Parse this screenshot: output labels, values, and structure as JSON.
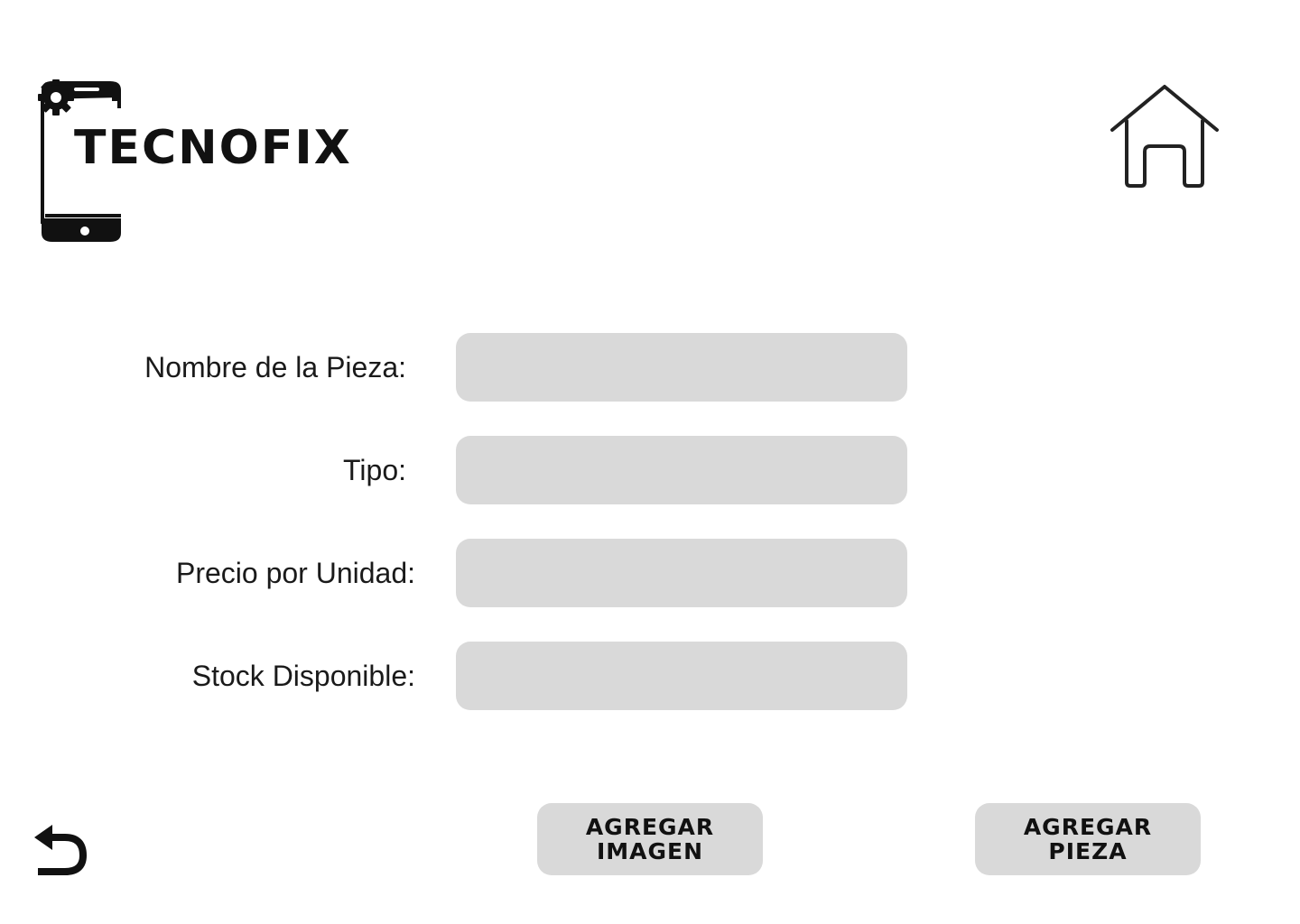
{
  "brand": {
    "name": "TECNOFIX",
    "logo_icon": "smartphone-icon",
    "gear_icon": "gear-icon"
  },
  "nav": {
    "home_icon": "home-icon",
    "back_icon": "undo-arrow-icon"
  },
  "form": {
    "fields": [
      {
        "label": "Nombre de la Pieza:",
        "value": ""
      },
      {
        "label": "Tipo:",
        "value": ""
      },
      {
        "label": "Precio por Unidad:",
        "value": ""
      },
      {
        "label": "Stock Disponible:",
        "value": ""
      }
    ]
  },
  "actions": {
    "add_image_label": "AGREGAR IMAGEN",
    "add_piece_label": "AGREGAR PIEZA"
  },
  "colors": {
    "background": "#ffffff",
    "input_fill": "#d9d9d9",
    "button_fill": "#d9d9d9",
    "text": "#111111"
  }
}
